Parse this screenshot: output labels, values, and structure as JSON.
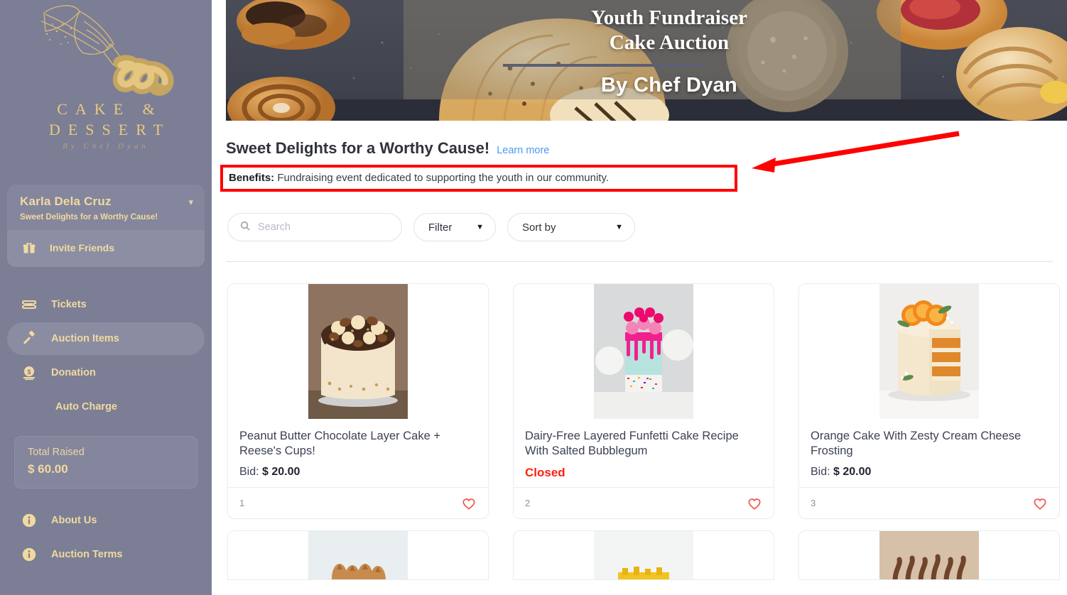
{
  "sidebar": {
    "logo": {
      "title_line1": "CAKE &",
      "title_line2": "DESSERT",
      "subtitle": "By Chef Dyan",
      "icon": "piping-bag-icon"
    },
    "user": {
      "name": "Karla Dela Cruz",
      "tagline": "Sweet Delights for a Worthy Cause!",
      "chevron": "chevron-down-icon"
    },
    "invite": {
      "label": "Invite Friends",
      "icon": "gift-icon"
    },
    "nav": [
      {
        "label": "Tickets",
        "icon": "ticket-icon",
        "active": false
      },
      {
        "label": "Auction Items",
        "icon": "gavel-icon",
        "active": true
      },
      {
        "label": "Donation",
        "icon": "money-circle-icon",
        "active": false
      },
      {
        "label": "Auto Charge",
        "icon": "none",
        "active": false
      }
    ],
    "total_raised": {
      "label": "Total Raised",
      "amount": "$ 60.00"
    },
    "nav2": [
      {
        "label": "About Us",
        "icon": "info-icon"
      },
      {
        "label": "Auction Terms",
        "icon": "info-icon"
      }
    ],
    "colors": {
      "background": "#7b7e95",
      "accent_gold": "#f2d9a0",
      "card": "#83869c"
    }
  },
  "banner": {
    "title_line1": "Youth Fundraiser",
    "title_line2": "Cake Auction",
    "byline": "By Chef Dyan"
  },
  "main": {
    "page_title": "Sweet Delights for a Worthy Cause!",
    "learn_more": "Learn more",
    "benefits_label": "Benefits:",
    "benefits_text": " Fundraising event dedicated to supporting the youth in our community.",
    "toolbar": {
      "search_placeholder": "Search",
      "search_value": "",
      "search_icon": "search-icon",
      "filter_label": "Filter",
      "sort_label": "Sort by",
      "caret": "▼"
    },
    "cards": [
      {
        "index": "1",
        "title": "Peanut Butter Chocolate Layer Cake + Reese's Cups!",
        "bid_label": "Bid: ",
        "bid_currency": "$ ",
        "bid_amount": "20.00",
        "status": null,
        "favorite_icon": "heart-outline-icon",
        "image": "chocolate-drip-cake"
      },
      {
        "index": "2",
        "title": "Dairy-Free Layered Funfetti Cake Recipe With Salted Bubblegum",
        "bid_label": null,
        "bid_currency": null,
        "bid_amount": null,
        "status": "Closed",
        "favorite_icon": "heart-outline-icon",
        "image": "funfetti-pink-cake"
      },
      {
        "index": "3",
        "title": "Orange Cake With Zesty Cream Cheese Frosting",
        "bid_label": "Bid: ",
        "bid_currency": "$ ",
        "bid_amount": "20.00",
        "status": null,
        "favorite_icon": "heart-outline-icon",
        "image": "orange-layer-cake"
      }
    ],
    "cards_partial": [
      {
        "image": "cinnamon-rolls"
      },
      {
        "image": "lemon-dessert"
      },
      {
        "image": "chocolate-swirl-cakes"
      }
    ]
  },
  "annotation": {
    "highlight_color": "#ff0000",
    "arrow": "red-arrow-pointing-left",
    "box": "red-rectangle-around-benefits"
  }
}
